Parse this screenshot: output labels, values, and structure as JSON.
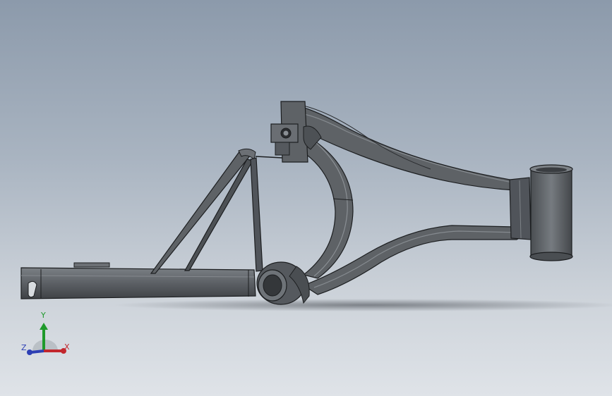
{
  "viewport": {
    "background_top": "#8c9aab",
    "background_bottom": "#dfe3e8"
  },
  "model": {
    "part_color": "#5e6266",
    "edge_color": "#1c1e20",
    "highlight_color": "#7e8388"
  },
  "triad": {
    "y_label": "Y",
    "x_label": "X",
    "z_label": "Z",
    "y_color": "#1f9a2b",
    "x_color": "#c2272d",
    "z_color": "#2d3fb4"
  }
}
